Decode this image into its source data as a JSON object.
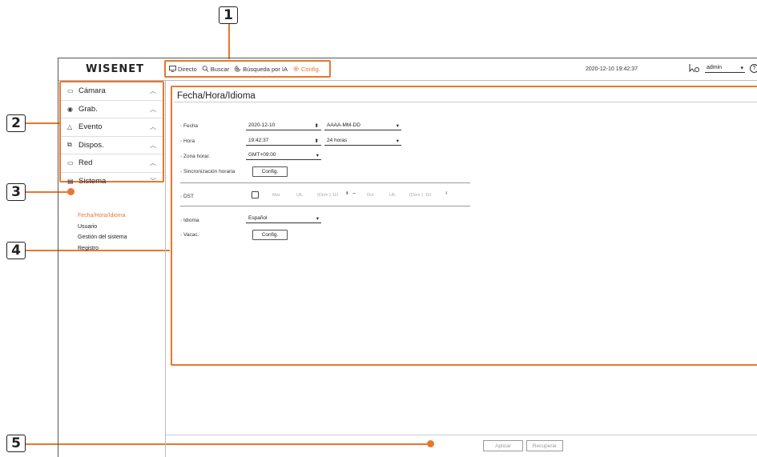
{
  "callouts": [
    "1",
    "2",
    "3",
    "4",
    "5"
  ],
  "header": {
    "logo": "WISENET",
    "nav": [
      {
        "label": "Directo",
        "icon": "monitor-icon"
      },
      {
        "label": "Buscar",
        "icon": "search-icon"
      },
      {
        "label": "Búsqueda por IA",
        "icon": "ai-search-icon"
      },
      {
        "label": "Config.",
        "icon": "gear-icon"
      }
    ],
    "datetime": "2020-12-10 19:42:37",
    "user": "admin",
    "help": "?"
  },
  "sidebar": {
    "menu": [
      {
        "label": "Cámara",
        "icon": "camera-icon",
        "chevron": "^"
      },
      {
        "label": "Grab.",
        "icon": "record-icon",
        "chevron": "^"
      },
      {
        "label": "Evento",
        "icon": "bell-icon",
        "chevron": "^"
      },
      {
        "label": "Dispos.",
        "icon": "device-icon",
        "chevron": "^"
      },
      {
        "label": "Red",
        "icon": "network-icon",
        "chevron": "^"
      },
      {
        "label": "Sistema",
        "icon": "system-icon",
        "chevron": "v"
      }
    ],
    "submenu": [
      "Fecha/Hora/Idioma",
      "Usuario",
      "Gestión del sistema",
      "Registro"
    ]
  },
  "main": {
    "title": "Fecha/Hora/Idioma",
    "fecha": {
      "label": "Fecha",
      "value": "2020-12-10",
      "format": "AAAA-MM-DD"
    },
    "hora": {
      "label": "Hora",
      "value": "19:42:37",
      "format": "24 horas"
    },
    "zona": {
      "label": "Zona horar.",
      "value": "GMT+09:00"
    },
    "sync": {
      "label": "Sincronización horaria",
      "button": "Config."
    },
    "dst": {
      "label": "DST",
      "start_month": "Mar",
      "start_week": "Ult.",
      "start_day": "(Dom.)",
      "start_hour": "1H",
      "sep": "~",
      "end_month": "Oct",
      "end_week": "Ult.",
      "end_day": "(Dom.)",
      "end_hour": "1H"
    },
    "idioma": {
      "label": "Idioma",
      "value": "Español"
    },
    "vacac": {
      "label": "Vacac.",
      "button": "Config."
    }
  },
  "footer": {
    "apply": "Aplicar",
    "recover": "Recuperar"
  },
  "colors": {
    "accent": "#e8772e"
  }
}
